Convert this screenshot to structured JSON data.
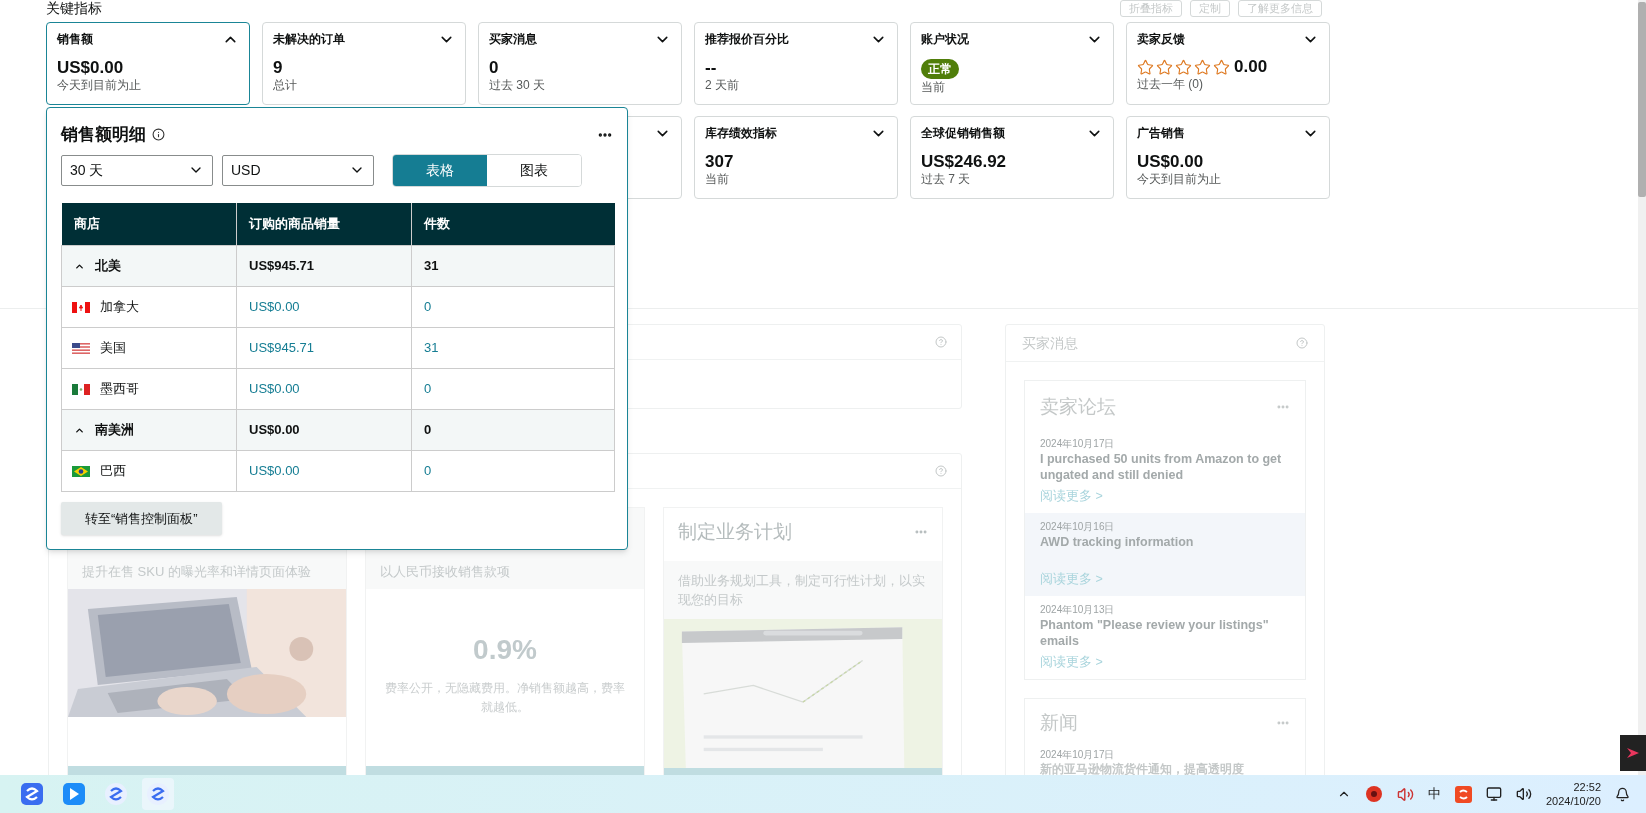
{
  "header": {
    "title": "关键指标",
    "buttons": [
      "折叠指标",
      "定制",
      "了解更多信息"
    ]
  },
  "metric_cards": [
    {
      "title": "销售额",
      "expanded": true,
      "selected": true,
      "kind": "value",
      "value": "US$0.00",
      "caption": "今天到目前为止"
    },
    {
      "title": "未解决的订单",
      "expanded": false,
      "selected": false,
      "kind": "value",
      "value": "9",
      "caption": "总计"
    },
    {
      "title": "买家消息",
      "expanded": false,
      "selected": false,
      "kind": "value",
      "value": "0",
      "caption": "过去 30 天"
    },
    {
      "title": "推荐报价百分比",
      "expanded": false,
      "selected": false,
      "kind": "value",
      "value": "--",
      "caption": "2 天前"
    },
    {
      "title": "账户状况",
      "expanded": false,
      "selected": false,
      "kind": "badge",
      "value": "正常",
      "caption": "当前"
    },
    {
      "title": "卖家反馈",
      "expanded": false,
      "selected": false,
      "kind": "stars",
      "stars": 0,
      "value": "0.00",
      "caption": "过去一年 (0)"
    },
    {
      "kind": "covered"
    },
    {
      "kind": "covered"
    },
    {
      "kind": "covered",
      "expanded": false,
      "selected": false
    },
    {
      "title": "库存绩效指标",
      "expanded": false,
      "selected": false,
      "kind": "value",
      "value": "307",
      "caption": "当前"
    },
    {
      "title": "全球促销销售额",
      "expanded": false,
      "selected": false,
      "kind": "value",
      "value": "US$246.92",
      "caption": "过去 7 天"
    },
    {
      "title": "广告销售",
      "expanded": false,
      "selected": false,
      "kind": "value",
      "value": "US$0.00",
      "caption": "今天到目前为止"
    }
  ],
  "popup": {
    "title": "销售额明细",
    "period": "30 天",
    "currency": "USD",
    "view_tabs": [
      {
        "label": "表格",
        "selected": true
      },
      {
        "label": "图表",
        "selected": false
      }
    ],
    "table": {
      "columns": [
        "商店",
        "订购的商品销量",
        "件数"
      ],
      "rows": [
        {
          "kind": "group",
          "expanded": true,
          "store": "北美",
          "sales": "US$945.71",
          "units": "31"
        },
        {
          "kind": "ca",
          "store": "加拿大",
          "sales": "US$0.00",
          "units": "0"
        },
        {
          "kind": "us",
          "store": "美国",
          "sales": "US$945.71",
          "units": "31"
        },
        {
          "kind": "mx",
          "store": "墨西哥",
          "sales": "US$0.00",
          "units": "0"
        },
        {
          "kind": "group",
          "expanded": true,
          "store": "南美洲",
          "sales": "US$0.00",
          "units": "0"
        },
        {
          "kind": "br",
          "store": "巴西",
          "sales": "US$0.00",
          "units": "0"
        }
      ]
    },
    "button": "转至“销售控制面板”"
  },
  "promo_cards": [
    {
      "description": "提升在售 SKU 的曝光率和详情页面体验"
    },
    {
      "kind": "rate",
      "description": "以人民币接收销售款项",
      "rate": "0.9%",
      "note": "费率公开，无隐藏费用。净销售额越高，费率就越低。"
    },
    {
      "kind": "screenshot",
      "title": "制定业务计划",
      "description": "借助业务规划工具，制定可行性计划，以实现您的目标"
    }
  ],
  "buyer_messages": {
    "title": "买家消息",
    "forum": {
      "title": "卖家论坛",
      "posts": [
        {
          "date": "2024年10月17日",
          "title": "I purchased 50 units from Amazon to get ungated and still denied",
          "link": "阅读更多 >",
          "highlighted": false
        },
        {
          "date": "2024年10月16日",
          "title": "AWD tracking information",
          "link": "阅读更多 >",
          "highlighted": true
        },
        {
          "date": "2024年10月13日",
          "title": "Phantom \"Please review your listings\" emails",
          "link": "阅读更多 >",
          "highlighted": false
        }
      ]
    },
    "news": {
      "title": "新闻",
      "date": "2024年10月17日",
      "headline": "新的亚马逊物流货件通知，提高透明度"
    }
  },
  "taskbar": {
    "ime": "中",
    "time": "22:52",
    "date": "2024/10/20"
  }
}
